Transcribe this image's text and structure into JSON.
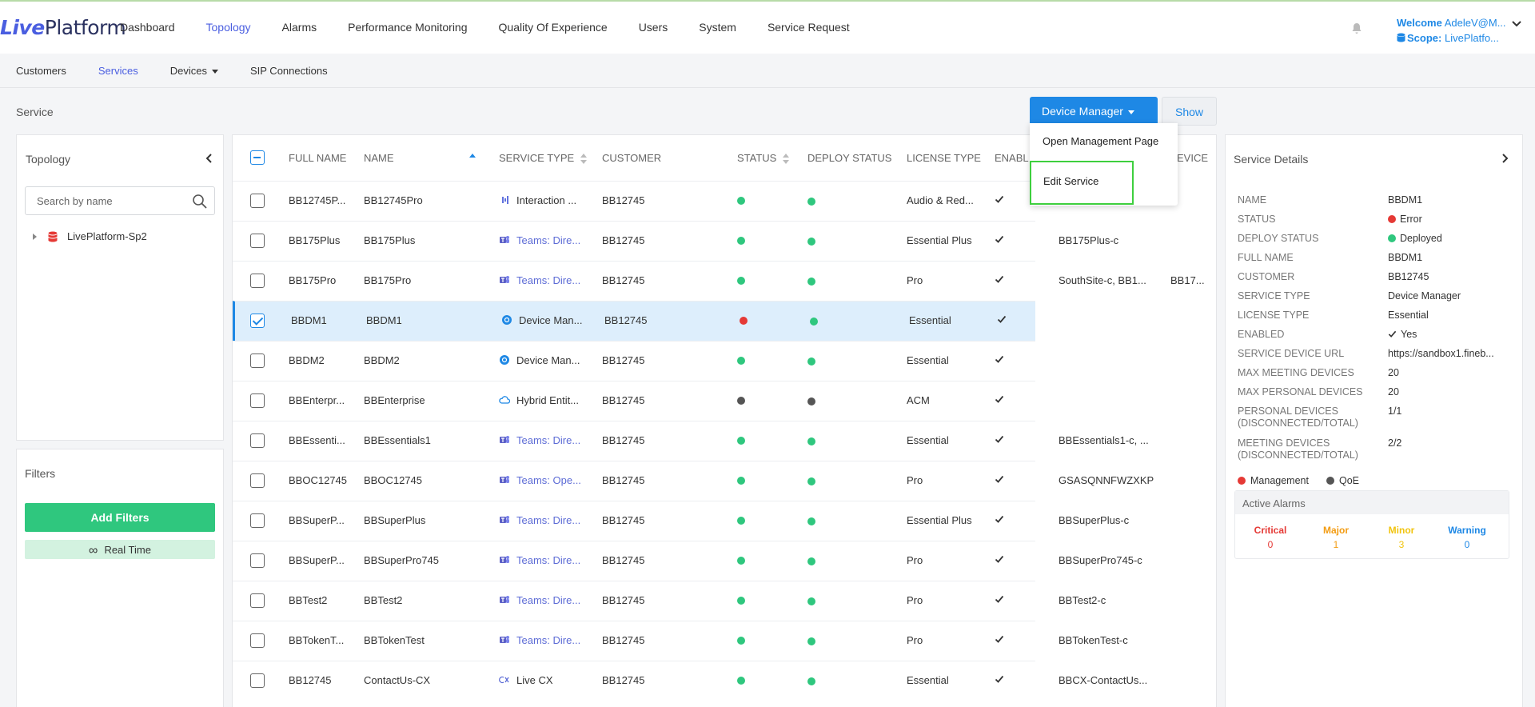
{
  "app": {
    "logo_a": "Live",
    "logo_b": "Platform"
  },
  "topnav": [
    "Dashboard",
    "Topology",
    "Alarms",
    "Performance Monitoring",
    "Quality Of Experience",
    "Users",
    "System",
    "Service Request"
  ],
  "topnav_active": "Topology",
  "user": {
    "welcome_label": "Welcome",
    "welcome_value": "AdeleV@M...",
    "scope_label": "Scope:",
    "scope_value": "LivePlatfo..."
  },
  "subnav": {
    "customers": "Customers",
    "services": "Services",
    "devices": "Devices",
    "sip": "SIP Connections"
  },
  "breadcrumb": "Service",
  "toolbar": {
    "device_manager": "Device Manager",
    "show": "Show",
    "menu": [
      "Open Management Page",
      "Edit Service"
    ]
  },
  "topology_panel": {
    "title": "Topology",
    "search_placeholder": "Search by name",
    "tree_root": "LivePlatform-Sp2"
  },
  "filters_panel": {
    "title": "Filters",
    "add_filters": "Add Filters",
    "real_time": "Real Time"
  },
  "table": {
    "headers": {
      "full_name": "FULL NAME",
      "name": "NAME",
      "service_type": "SERVICE TYPE",
      "customer": "CUSTOMER",
      "status": "STATUS",
      "deploy_status": "DEPLOY STATUS",
      "license_type": "LICENSE TYPE",
      "enabled": "ENABL",
      "device": "EVICE"
    },
    "rows": [
      {
        "full_name": "BB12745P...",
        "name": "BB12745Pro",
        "service_type": "Interaction ...",
        "type_icon": "waveform-icon",
        "type_link": false,
        "customer": "BB12745",
        "status": "green",
        "deploy": "green",
        "license": "Audio & Red...",
        "enabled": true,
        "col9": "",
        "col10": "",
        "selected": false
      },
      {
        "full_name": "BB175Plus",
        "name": "BB175Plus",
        "service_type": "Teams: Dire...",
        "type_icon": "teams-icon",
        "type_link": true,
        "customer": "BB12745",
        "status": "green",
        "deploy": "green",
        "license": "Essential Plus",
        "enabled": true,
        "col9": "BB175Plus-c",
        "col10": "",
        "selected": false
      },
      {
        "full_name": "BB175Pro",
        "name": "BB175Pro",
        "service_type": "Teams: Dire...",
        "type_icon": "teams-icon",
        "type_link": true,
        "customer": "BB12745",
        "status": "green",
        "deploy": "green",
        "license": "Pro",
        "enabled": true,
        "col9": "SouthSite-c, BB1...",
        "col10": "BB17...",
        "selected": false
      },
      {
        "full_name": "BBDM1",
        "name": "BBDM1",
        "service_type": "Device Man...",
        "type_icon": "device-manager-icon",
        "type_link": false,
        "customer": "BB12745",
        "status": "red",
        "deploy": "green",
        "license": "Essential",
        "enabled": true,
        "col9": "",
        "col10": "",
        "selected": true
      },
      {
        "full_name": "BBDM2",
        "name": "BBDM2",
        "service_type": "Device Man...",
        "type_icon": "device-manager-icon",
        "type_link": false,
        "customer": "BB12745",
        "status": "green",
        "deploy": "green",
        "license": "Essential",
        "enabled": true,
        "col9": "",
        "col10": "",
        "selected": false
      },
      {
        "full_name": "BBEnterpr...",
        "name": "BBEnterprise",
        "service_type": "Hybrid Entit...",
        "type_icon": "cloud-icon",
        "type_link": false,
        "customer": "BB12745",
        "status": "gray",
        "deploy": "gray",
        "license": "ACM",
        "enabled": true,
        "col9": "",
        "col10": "",
        "selected": false
      },
      {
        "full_name": "BBEssenti...",
        "name": "BBEssentials1",
        "service_type": "Teams: Dire...",
        "type_icon": "teams-icon",
        "type_link": true,
        "customer": "BB12745",
        "status": "green",
        "deploy": "green",
        "license": "Essential",
        "enabled": true,
        "col9": "BBEssentials1-c, ...",
        "col10": "",
        "selected": false
      },
      {
        "full_name": "BBOC12745",
        "name": "BBOC12745",
        "service_type": "Teams: Ope...",
        "type_icon": "teams-icon",
        "type_link": true,
        "customer": "BB12745",
        "status": "green",
        "deploy": "green",
        "license": "Pro",
        "enabled": true,
        "col9": "GSASQNNFWZXKP",
        "col10": "",
        "selected": false
      },
      {
        "full_name": "BBSuperP...",
        "name": "BBSuperPlus",
        "service_type": "Teams: Dire...",
        "type_icon": "teams-icon",
        "type_link": true,
        "customer": "BB12745",
        "status": "green",
        "deploy": "green",
        "license": "Essential Plus",
        "enabled": true,
        "col9": "BBSuperPlus-c",
        "col10": "",
        "selected": false
      },
      {
        "full_name": "BBSuperP...",
        "name": "BBSuperPro745",
        "service_type": "Teams: Dire...",
        "type_icon": "teams-icon",
        "type_link": true,
        "customer": "BB12745",
        "status": "green",
        "deploy": "green",
        "license": "Pro",
        "enabled": true,
        "col9": "BBSuperPro745-c",
        "col10": "",
        "selected": false
      },
      {
        "full_name": "BBTest2",
        "name": "BBTest2",
        "service_type": "Teams: Dire...",
        "type_icon": "teams-icon",
        "type_link": true,
        "customer": "BB12745",
        "status": "green",
        "deploy": "green",
        "license": "Pro",
        "enabled": true,
        "col9": "BBTest2-c",
        "col10": "",
        "selected": false
      },
      {
        "full_name": "BBTokenT...",
        "name": "BBTokenTest",
        "service_type": "Teams: Dire...",
        "type_icon": "teams-icon",
        "type_link": true,
        "customer": "BB12745",
        "status": "green",
        "deploy": "green",
        "license": "Pro",
        "enabled": true,
        "col9": "BBTokenTest-c",
        "col10": "",
        "selected": false
      },
      {
        "full_name": "BB12745",
        "name": "ContactUs-CX",
        "service_type": "Live CX",
        "type_icon": "live-cx-icon",
        "type_link": false,
        "customer": "BB12745",
        "status": "green",
        "deploy": "green",
        "license": "Essential",
        "enabled": true,
        "col9": "BBCX-ContactUs...",
        "col10": "",
        "selected": false
      }
    ]
  },
  "details": {
    "title": "Service Details",
    "items": [
      {
        "key": "NAME",
        "value": "BBDM1",
        "dot": ""
      },
      {
        "key": "STATUS",
        "value": "Error",
        "dot": "red"
      },
      {
        "key": "DEPLOY STATUS",
        "value": "Deployed",
        "dot": "green"
      },
      {
        "key": "FULL NAME",
        "value": "BBDM1",
        "dot": ""
      },
      {
        "key": "CUSTOMER",
        "value": "BB12745",
        "dot": ""
      },
      {
        "key": "SERVICE TYPE",
        "value": "Device Manager",
        "dot": ""
      },
      {
        "key": "LICENSE TYPE",
        "value": "Essential",
        "dot": ""
      },
      {
        "key": "ENABLED",
        "value": "Yes",
        "dot": "check"
      },
      {
        "key": "SERVICE DEVICE URL",
        "value": "https://sandbox1.fineb...",
        "dot": ""
      },
      {
        "key": "MAX MEETING DEVICES",
        "value": "20",
        "dot": ""
      },
      {
        "key": "MAX PERSONAL DEVICES",
        "value": "20",
        "dot": ""
      },
      {
        "key": "PERSONAL DEVICES (DISCONNECTED/TOTAL)",
        "value": "1/1",
        "dot": ""
      },
      {
        "key": "MEETING DEVICES (DISCONNECTED/TOTAL)",
        "value": "2/2",
        "dot": ""
      }
    ],
    "legend_management": "Management",
    "legend_qoe": "QoE",
    "alarms_title": "Active Alarms",
    "alarms": [
      {
        "label": "Critical",
        "count": "0",
        "color": "#e53935"
      },
      {
        "label": "Major",
        "count": "1",
        "color": "#f39c12"
      },
      {
        "label": "Minor",
        "count": "3",
        "color": "#f1c40f"
      },
      {
        "label": "Warning",
        "count": "0",
        "color": "#1e88e5"
      }
    ]
  },
  "colors": {
    "accent": "#1e88e5",
    "nav_active": "#4a5ee0",
    "green": "#2fc77e",
    "red": "#e53935",
    "gray": "#555555"
  }
}
